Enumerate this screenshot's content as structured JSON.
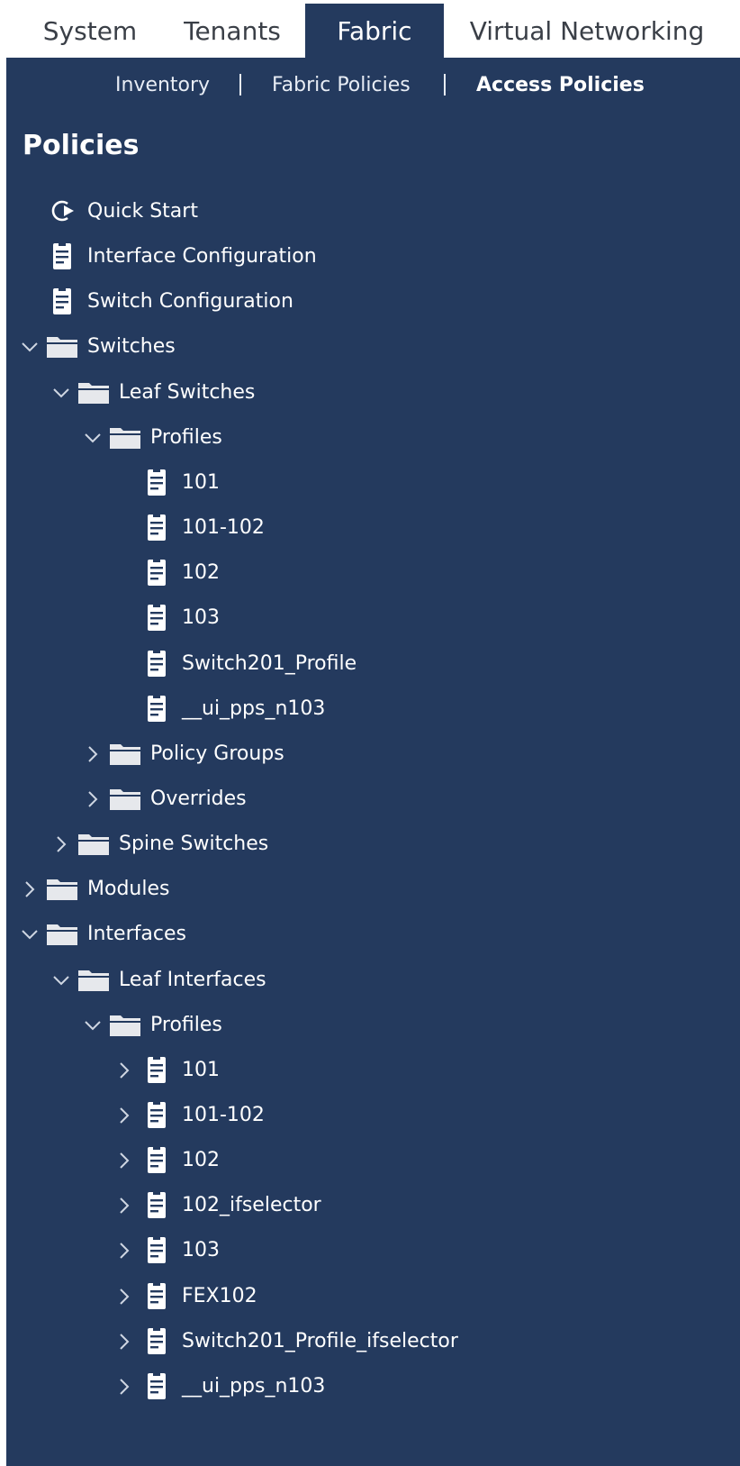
{
  "top_tabs": [
    {
      "label": "System",
      "active": false
    },
    {
      "label": "Tenants",
      "active": false
    },
    {
      "label": "Fabric",
      "active": true
    },
    {
      "label": "Virtual Networking",
      "active": false
    }
  ],
  "sub_nav": [
    {
      "label": "Inventory",
      "active": false
    },
    {
      "label": "Fabric Policies",
      "active": false
    },
    {
      "label": "Access Policies",
      "active": true
    }
  ],
  "panel": {
    "title": "Policies"
  },
  "tree": [
    {
      "label": "Quick Start",
      "icon": "quick-start-icon",
      "level": 0,
      "caret": "none"
    },
    {
      "label": "Interface Configuration",
      "icon": "document-icon",
      "level": 0,
      "caret": "none"
    },
    {
      "label": "Switch Configuration",
      "icon": "document-icon",
      "level": 0,
      "caret": "none"
    },
    {
      "label": "Switches",
      "icon": "folder-icon",
      "level": 0,
      "caret": "expanded"
    },
    {
      "label": "Leaf Switches",
      "icon": "folder-icon",
      "level": 1,
      "caret": "expanded"
    },
    {
      "label": "Profiles",
      "icon": "folder-icon",
      "level": 2,
      "caret": "expanded"
    },
    {
      "label": "101",
      "icon": "document-icon",
      "level": 3,
      "caret": "none"
    },
    {
      "label": "101-102",
      "icon": "document-icon",
      "level": 3,
      "caret": "none"
    },
    {
      "label": "102",
      "icon": "document-icon",
      "level": 3,
      "caret": "none"
    },
    {
      "label": "103",
      "icon": "document-icon",
      "level": 3,
      "caret": "none"
    },
    {
      "label": "Switch201_Profile",
      "icon": "document-icon",
      "level": 3,
      "caret": "none"
    },
    {
      "label": "__ui_pps_n103",
      "icon": "document-icon",
      "level": 3,
      "caret": "none"
    },
    {
      "label": "Policy Groups",
      "icon": "folder-icon",
      "level": 2,
      "caret": "collapsed"
    },
    {
      "label": "Overrides",
      "icon": "folder-icon",
      "level": 2,
      "caret": "collapsed"
    },
    {
      "label": "Spine Switches",
      "icon": "folder-icon",
      "level": 1,
      "caret": "collapsed"
    },
    {
      "label": "Modules",
      "icon": "folder-icon",
      "level": 0,
      "caret": "collapsed"
    },
    {
      "label": "Interfaces",
      "icon": "folder-icon",
      "level": 0,
      "caret": "expanded"
    },
    {
      "label": "Leaf Interfaces",
      "icon": "folder-icon",
      "level": 1,
      "caret": "expanded"
    },
    {
      "label": "Profiles",
      "icon": "folder-icon",
      "level": 2,
      "caret": "expanded"
    },
    {
      "label": "101",
      "icon": "document-icon",
      "level": 3,
      "caret": "collapsed"
    },
    {
      "label": "101-102",
      "icon": "document-icon",
      "level": 3,
      "caret": "collapsed"
    },
    {
      "label": "102",
      "icon": "document-icon",
      "level": 3,
      "caret": "collapsed"
    },
    {
      "label": "102_ifselector",
      "icon": "document-icon",
      "level": 3,
      "caret": "collapsed"
    },
    {
      "label": "103",
      "icon": "document-icon",
      "level": 3,
      "caret": "collapsed"
    },
    {
      "label": "FEX102",
      "icon": "document-icon",
      "level": 3,
      "caret": "collapsed"
    },
    {
      "label": "Switch201_Profile_ifselector",
      "icon": "document-icon",
      "level": 3,
      "caret": "collapsed"
    },
    {
      "label": "__ui_pps_n103",
      "icon": "document-icon",
      "level": 3,
      "caret": "collapsed"
    }
  ],
  "colors": {
    "panel_bg": "#243a5e",
    "text": "#ffffff",
    "folder": "#e6e8ec",
    "tab_text": "#3a3f47"
  }
}
